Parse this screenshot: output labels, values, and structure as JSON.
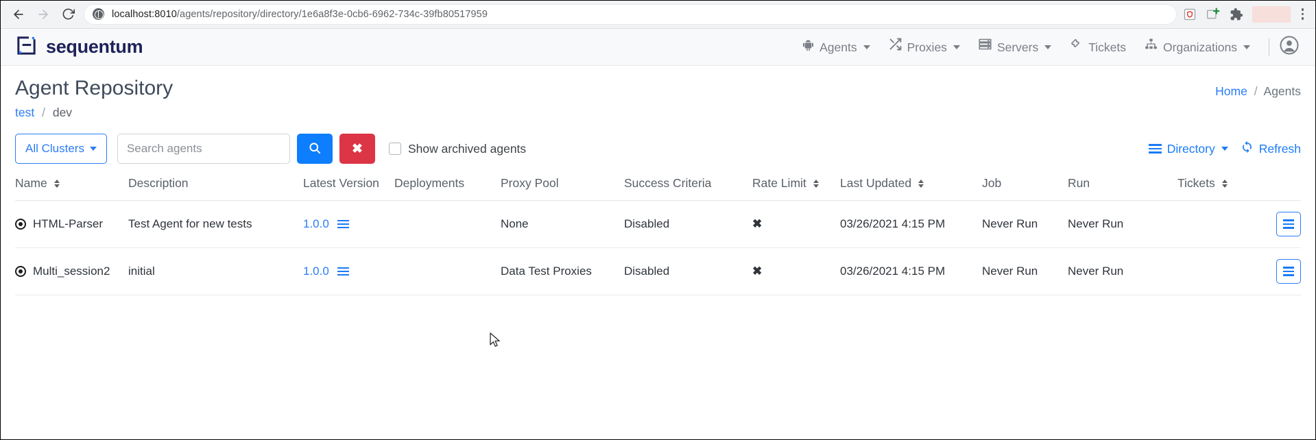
{
  "browser": {
    "url_host": "localhost:8010",
    "url_path": "/agents/repository/directory/1e6a8f3e-0cb6-6962-734c-39fb80517959",
    "back_icon": "back-arrow-icon",
    "forward_icon": "forward-arrow-icon",
    "reload_icon": "reload-icon",
    "site_icon": "globe-icon",
    "extensions": [
      "shield-extension-icon",
      "add-extension-icon",
      "puzzle-extension-icon"
    ],
    "menu_icon": "browser-menu-icon"
  },
  "navbar": {
    "brand": "sequentum",
    "items": [
      {
        "label": "Agents",
        "icon": "android-robot-icon",
        "has_caret": true
      },
      {
        "label": "Proxies",
        "icon": "shuffle-icon",
        "has_caret": true
      },
      {
        "label": "Servers",
        "icon": "server-stack-icon",
        "has_caret": true
      },
      {
        "label": "Tickets",
        "icon": "ticket-icon",
        "has_caret": false
      },
      {
        "label": "Organizations",
        "icon": "sitemap-icon",
        "has_caret": true
      }
    ],
    "account_icon": "user-avatar-icon"
  },
  "page": {
    "title": "Agent Repository",
    "breadcrumb_right": {
      "link": "Home",
      "separator": "/",
      "current": "Agents"
    },
    "breadcrumb_sub": {
      "link": "test",
      "separator": "/",
      "current": "dev"
    }
  },
  "toolbar": {
    "clusters_label": "All Clusters",
    "search_value": "",
    "search_placeholder": "Search agents",
    "search_button_icon": "search-icon",
    "clear_button_label": "✖",
    "archived_label": "Show archived agents",
    "archived_checked": false,
    "directory_label": "Directory",
    "directory_icon": "list-icon",
    "refresh_label": "Refresh",
    "refresh_icon": "sync-icon"
  },
  "table": {
    "columns": [
      {
        "label": "Name",
        "sortable": true
      },
      {
        "label": "Description",
        "sortable": false
      },
      {
        "label": "Latest Version",
        "sortable": false
      },
      {
        "label": "Deployments",
        "sortable": false
      },
      {
        "label": "Proxy Pool",
        "sortable": false
      },
      {
        "label": "Success Criteria",
        "sortable": false
      },
      {
        "label": "Rate Limit",
        "sortable": true
      },
      {
        "label": "Last Updated",
        "sortable": true
      },
      {
        "label": "Job",
        "sortable": false
      },
      {
        "label": "Run",
        "sortable": false
      },
      {
        "label": "Tickets",
        "sortable": true
      }
    ],
    "rows": [
      {
        "name": "HTML-Parser",
        "description": "Test Agent for new tests",
        "latest_version": "1.0.0",
        "deployments": "",
        "proxy_pool": "None",
        "success_criteria": "Disabled",
        "rate_limit": "✖",
        "last_updated": "03/26/2021 4:15 PM",
        "job": "Never Run",
        "run": "Never Run",
        "tickets": ""
      },
      {
        "name": "Multi_session2",
        "description": "initial",
        "latest_version": "1.0.0",
        "deployments": "",
        "proxy_pool": "Data Test Proxies",
        "success_criteria": "Disabled",
        "rate_limit": "✖",
        "last_updated": "03/26/2021 4:15 PM",
        "job": "Never Run",
        "run": "Never Run",
        "tickets": ""
      }
    ]
  },
  "colors": {
    "accent_blue": "#2a7cf7",
    "button_blue": "#0d7efd",
    "danger_red": "#dc3545",
    "brand_navy": "#1e2259",
    "title_slate": "#3e4b5b",
    "muted_gray": "#adb2b8"
  }
}
